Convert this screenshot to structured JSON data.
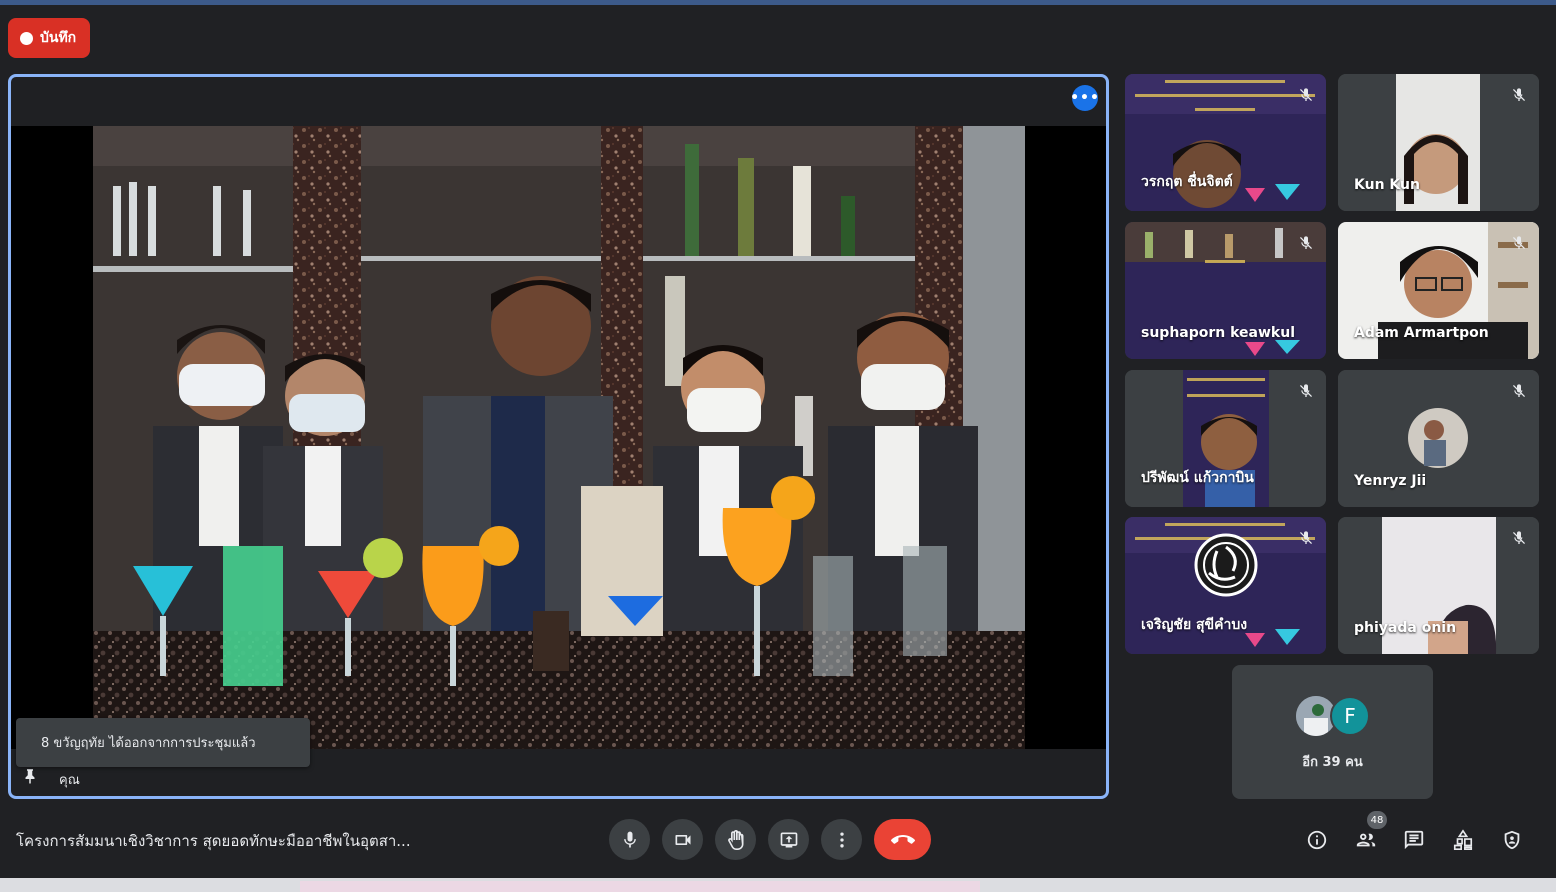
{
  "colors": {
    "background": "#202124",
    "active_speaker_border": "#8ab4f8",
    "record": "#d93025",
    "end_call": "#ea4335",
    "tile": "#3c4043"
  },
  "recording": {
    "label": "บันทึก",
    "icon": "record-dot-icon"
  },
  "main_video": {
    "participant_name": "คุณ",
    "more_options_icon": "more-horiz-icon",
    "pin_icon": "pin-icon"
  },
  "toast": {
    "message": "8 ขวัญฤทัย ได้ออกจากการประชุมแล้ว"
  },
  "participants": [
    {
      "name": "วรกฤต ชื่นจิตต์",
      "muted": true
    },
    {
      "name": "Kun Kun",
      "muted": true
    },
    {
      "name": "suphaporn keawkul",
      "muted": true
    },
    {
      "name": "Adam Armartpon",
      "muted": true
    },
    {
      "name": "ปรีพัฒน์ แก้วกาบิน",
      "muted": true
    },
    {
      "name": "Yenryz Jii",
      "muted": true
    },
    {
      "name": "เจริญชัย สุขีคำบง",
      "muted": true
    },
    {
      "name": "phiyada onin",
      "muted": true
    }
  ],
  "more_participants": {
    "label": "อีก 39 คน",
    "avatar_letter": "F"
  },
  "meeting": {
    "title": "โครงการสัมมนาเชิงวิชาการ สุดยอดทักษะมืออาชีพในอุตสา..."
  },
  "controls": [
    {
      "name": "microphone",
      "icon": "mic-icon"
    },
    {
      "name": "camera",
      "icon": "videocam-icon"
    },
    {
      "name": "raise-hand",
      "icon": "hand-icon"
    },
    {
      "name": "present",
      "icon": "present-screen-icon"
    },
    {
      "name": "more-options",
      "icon": "more-vert-icon"
    },
    {
      "name": "leave-call",
      "icon": "call-end-icon"
    }
  ],
  "right_controls": {
    "participants_count": "48",
    "icons": [
      "info-icon",
      "people-icon",
      "chat-icon",
      "activities-icon",
      "host-controls-icon"
    ]
  }
}
